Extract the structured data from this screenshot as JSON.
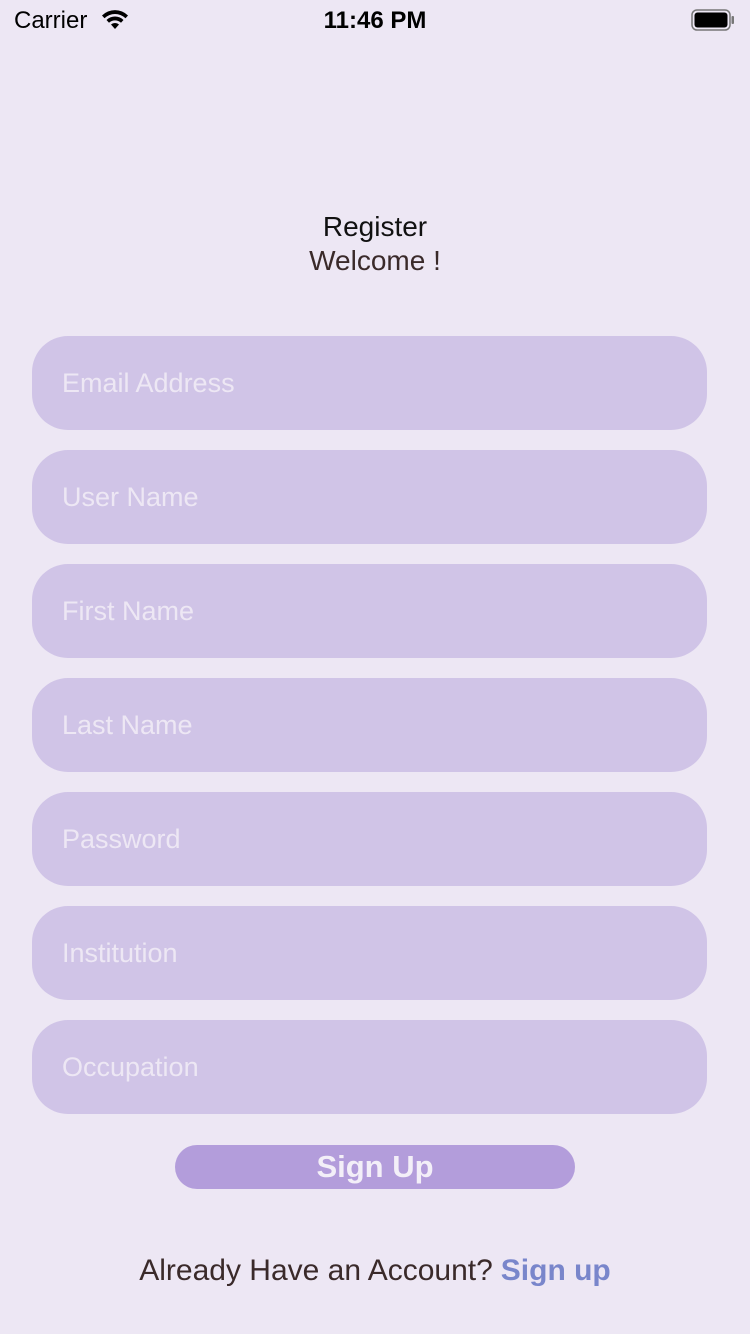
{
  "status_bar": {
    "carrier": "Carrier",
    "time": "11:46 PM",
    "wifi_icon": "wifi-icon",
    "battery_icon": "battery-icon"
  },
  "header": {
    "title": "Register",
    "subtitle": "Welcome !"
  },
  "form": {
    "fields": [
      {
        "placeholder": "Email Address",
        "value": ""
      },
      {
        "placeholder": "User Name",
        "value": ""
      },
      {
        "placeholder": "First Name",
        "value": ""
      },
      {
        "placeholder": "Last Name",
        "value": ""
      },
      {
        "placeholder": "Password",
        "value": ""
      },
      {
        "placeholder": "Institution",
        "value": ""
      },
      {
        "placeholder": "Occupation",
        "value": ""
      }
    ],
    "submit_label": "Sign Up"
  },
  "footer": {
    "prompt": "Already Have an Account?",
    "link_label": "Sign up"
  },
  "colors": {
    "background": "#EDE7F4",
    "field_background": "#D0C4E7",
    "button_background": "#B39DDB",
    "link": "#7986CB"
  }
}
